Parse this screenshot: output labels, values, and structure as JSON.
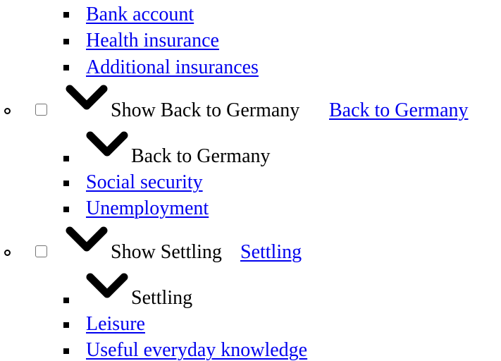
{
  "menu": {
    "top_items": [
      {
        "label": "Bank account"
      },
      {
        "label": "Health insurance"
      },
      {
        "label": "Additional insurances"
      }
    ],
    "sections": [
      {
        "toggle_text": "Show Back to Germany",
        "link_label": "Back to Germany ",
        "heading": "Back to Germany",
        "items": [
          {
            "label": "Social security"
          },
          {
            "label": "Unemployment"
          }
        ]
      },
      {
        "toggle_text": "Show Settling",
        "link_label": "Settling ",
        "heading": "Settling",
        "items": [
          {
            "label": "Leisure"
          },
          {
            "label": "Useful everyday knowledge"
          }
        ]
      }
    ]
  },
  "colors": {
    "link": "#0000ee",
    "text": "#000000",
    "checkbox_border": "#767676"
  },
  "icons": {
    "chevron": "chevron-down-icon",
    "bullet_square": "square-bullet-icon",
    "bullet_circle": "circle-bullet-icon"
  }
}
